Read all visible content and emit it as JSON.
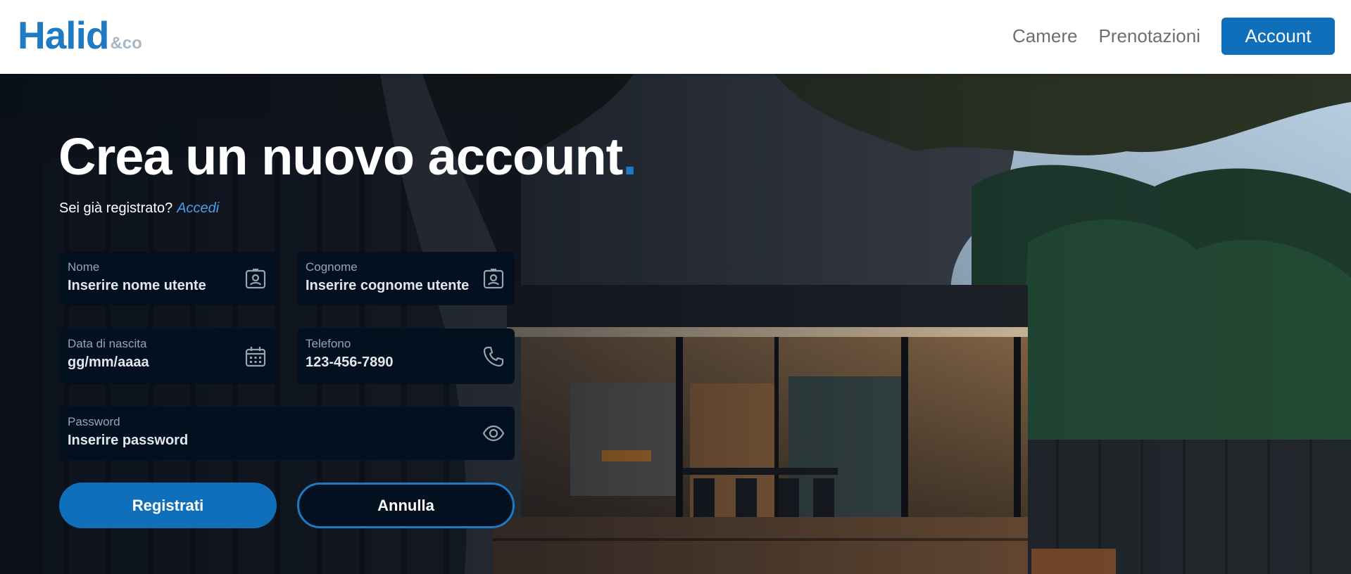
{
  "header": {
    "logo_main": "Halid",
    "logo_sub": "&co",
    "nav": [
      "Camere",
      "Prenotazioni"
    ],
    "account_label": "Account"
  },
  "hero": {
    "title": "Crea un nuovo account",
    "title_dot": ".",
    "subtitle": "Sei già registrato?",
    "login_link": "Accedi"
  },
  "form": {
    "nome": {
      "label": "Nome",
      "placeholder": "Inserire nome utente",
      "icon": "contact-card-icon"
    },
    "cognome": {
      "label": "Cognome",
      "placeholder": "Inserire cognome utente",
      "icon": "contact-card-icon"
    },
    "nascita": {
      "label": "Data di nascita",
      "placeholder": "gg/mm/aaaa",
      "icon": "calendar-icon"
    },
    "telefono": {
      "label": "Telefono",
      "placeholder": "123-456-7890",
      "icon": "phone-icon"
    },
    "password": {
      "label": "Password",
      "placeholder": "Inserire password",
      "icon": "eye-icon"
    },
    "submit_label": "Registrati",
    "cancel_label": "Annulla"
  },
  "colors": {
    "accent": "#0f6fba",
    "field_bg": "#03101f",
    "header_bg": "#ffffff"
  }
}
